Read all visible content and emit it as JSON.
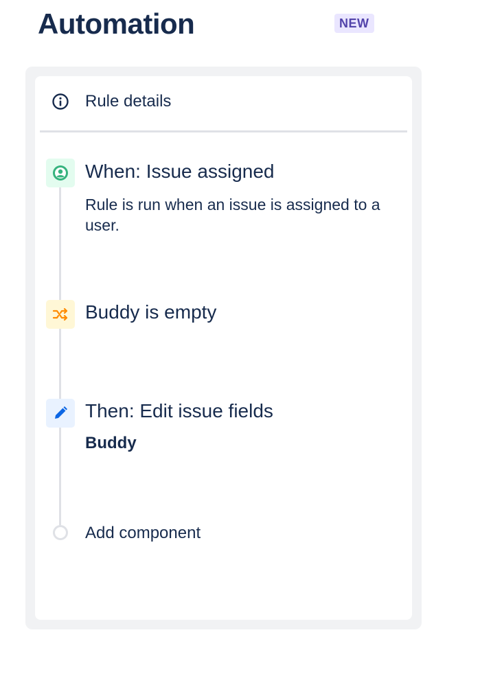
{
  "header": {
    "title": "Automation",
    "badge": "NEW"
  },
  "panel": {
    "rule_details": {
      "label": "Rule details",
      "icon": "info-icon"
    },
    "steps": [
      {
        "type": "trigger",
        "icon": "user-circle-icon",
        "title": "When: Issue assigned",
        "description": "Rule is run when an issue is assigned to a user."
      },
      {
        "type": "condition",
        "icon": "shuffle-icon",
        "title": "Buddy is empty"
      },
      {
        "type": "action",
        "icon": "pencil-icon",
        "title": "Then: Edit issue fields",
        "detail": "Buddy"
      }
    ],
    "add_component": {
      "label": "Add component"
    }
  },
  "colors": {
    "text": "#172b4d",
    "badge_bg": "#eae6ff",
    "badge_text": "#5243aa",
    "trigger_green": "#36b37e",
    "condition_orange": "#ff8b00",
    "action_blue": "#0c66e4"
  }
}
